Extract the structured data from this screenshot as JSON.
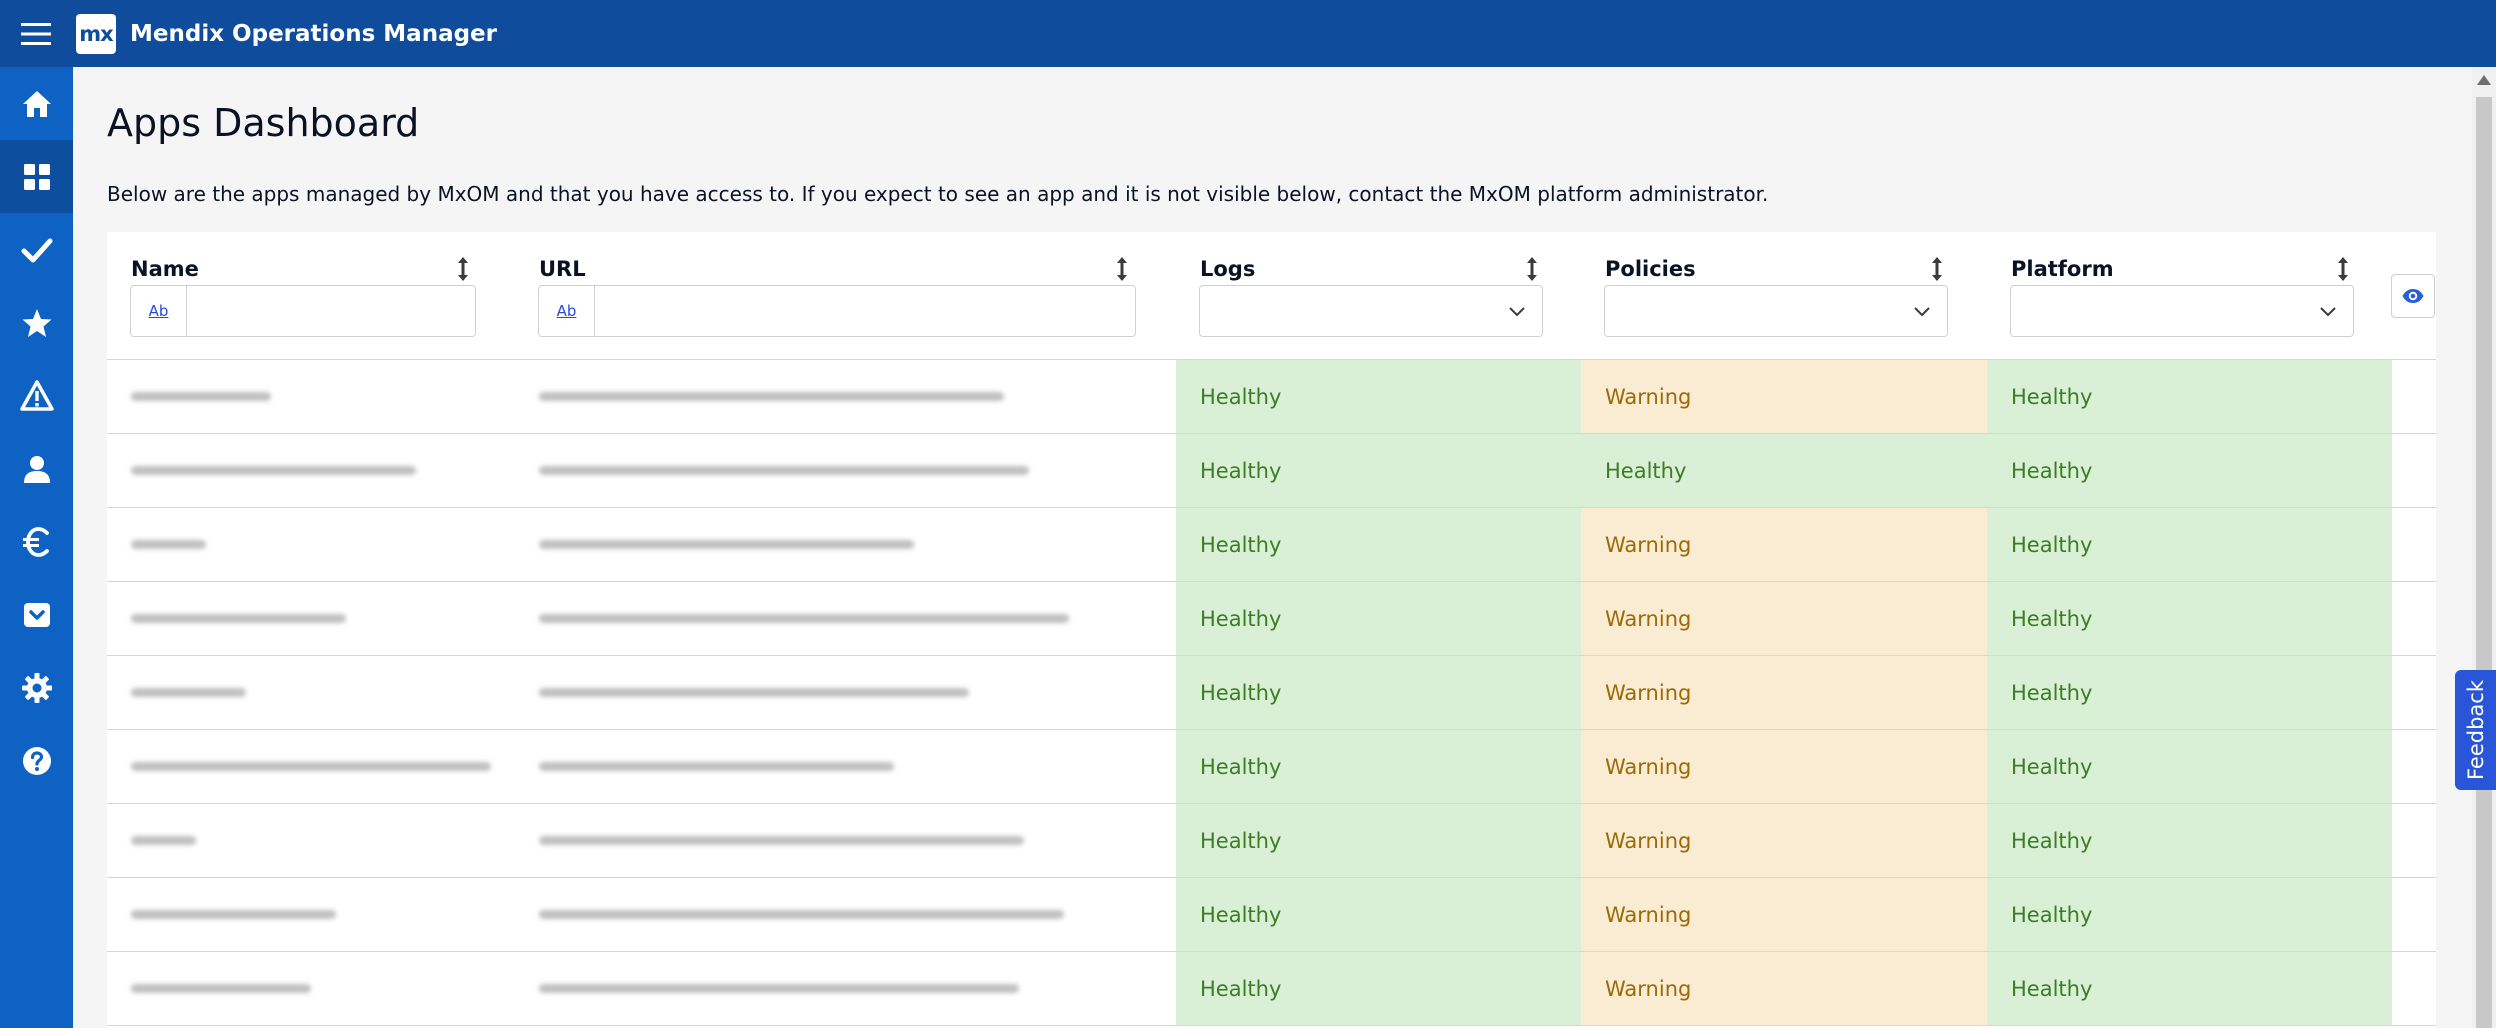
{
  "header": {
    "logo_text": "mx",
    "app_title": "Mendix Operations Manager"
  },
  "sidebar": {
    "items": [
      {
        "name": "home",
        "icon": "home-icon"
      },
      {
        "name": "apps-dashboard",
        "icon": "grid-icon",
        "active": true
      },
      {
        "name": "checks",
        "icon": "checkmark-icon"
      },
      {
        "name": "favorites",
        "icon": "star-icon"
      },
      {
        "name": "alerts",
        "icon": "warning-icon"
      },
      {
        "name": "users",
        "icon": "user-icon"
      },
      {
        "name": "costs",
        "icon": "euro-icon"
      },
      {
        "name": "inbox",
        "icon": "inbox-icon"
      },
      {
        "name": "settings",
        "icon": "gear-icon"
      },
      {
        "name": "help",
        "icon": "help-icon"
      }
    ]
  },
  "page": {
    "title": "Apps Dashboard",
    "description": "Below are the apps managed by MxOM and that you have access to. If you expect to see an app and it is not visible below, contact the MxOM platform administrator."
  },
  "table": {
    "columns": {
      "name": "Name",
      "url": "URL",
      "logs": "Logs",
      "policies": "Policies",
      "platform": "Platform"
    },
    "filter_ab_label": "Ab",
    "name_filter_value": "",
    "url_filter_value": "",
    "rows": [
      {
        "logs": "Healthy",
        "policies": "Warning",
        "platform": "Healthy"
      },
      {
        "logs": "Healthy",
        "policies": "Healthy",
        "platform": "Healthy"
      },
      {
        "logs": "Healthy",
        "policies": "Warning",
        "platform": "Healthy"
      },
      {
        "logs": "Healthy",
        "policies": "Warning",
        "platform": "Healthy"
      },
      {
        "logs": "Healthy",
        "policies": "Warning",
        "platform": "Healthy"
      },
      {
        "logs": "Healthy",
        "policies": "Warning",
        "platform": "Healthy"
      },
      {
        "logs": "Healthy",
        "policies": "Warning",
        "platform": "Healthy"
      },
      {
        "logs": "Healthy",
        "policies": "Warning",
        "platform": "Healthy"
      },
      {
        "logs": "Healthy",
        "policies": "Warning",
        "platform": "Healthy"
      }
    ]
  },
  "feedback_label": "Feedback",
  "colors": {
    "topbar": "#0f4c9b",
    "sidebar": "#0e62c3",
    "healthy_bg": "#d9f0d7",
    "healthy_text": "#3b7d23",
    "warning_bg": "#faebd3",
    "warning_text": "#9a6a05"
  }
}
